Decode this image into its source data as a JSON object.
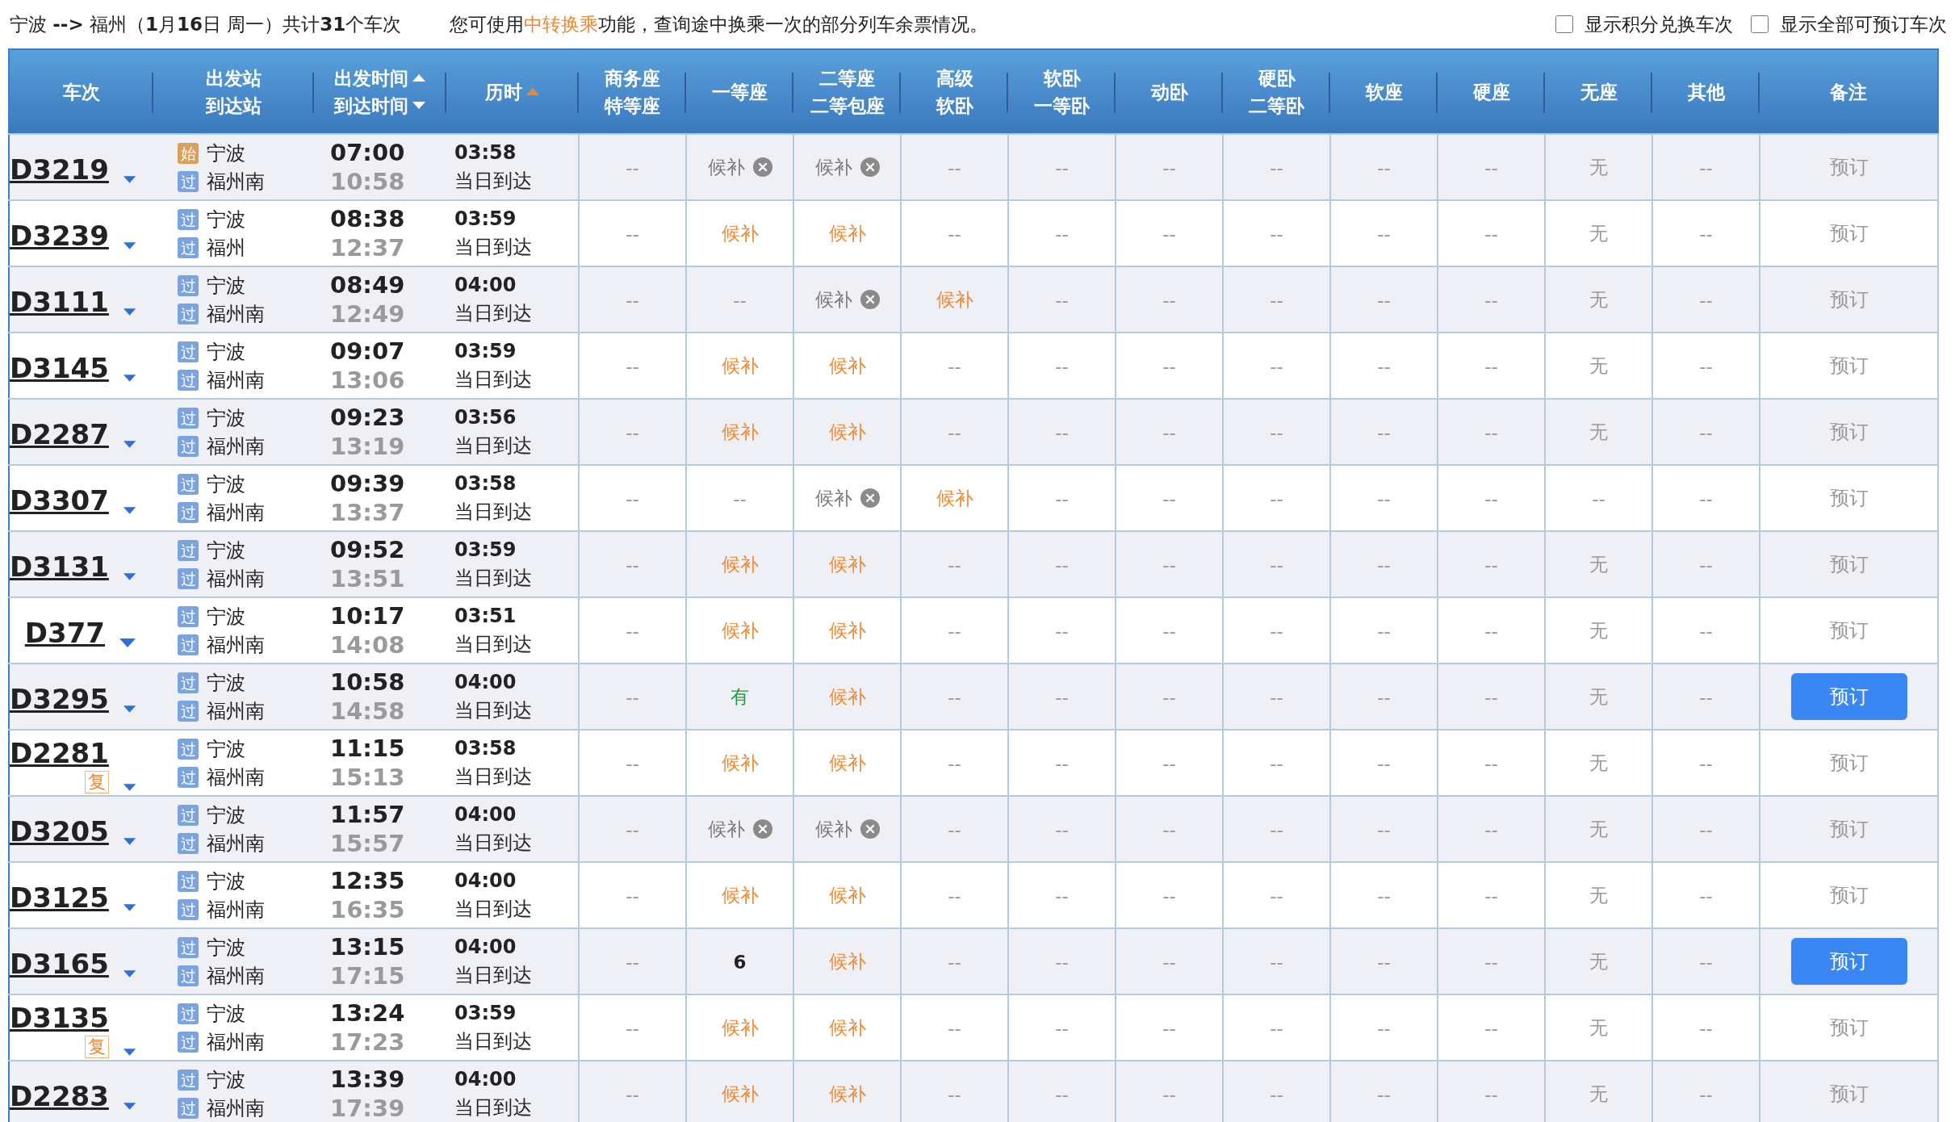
{
  "summary": {
    "text": "宁波 **-->** 福州（**1**月**16**日  周一）共计**31**个车次",
    "hint_before": "您可使用",
    "hint_link": "中转换乘",
    "hint_after": "功能，查询途中换乘一次的部分列车余票情况。"
  },
  "filters": [
    {
      "label": "显示积分兑换车次",
      "checked": false
    },
    {
      "label": "显示全部可预订车次",
      "checked": false
    }
  ],
  "table": {
    "columns": [
      {
        "lines": [
          {
            "text": "车次"
          }
        ]
      },
      {
        "lines": [
          {
            "text": "出发站"
          },
          {
            "text": "到达站"
          }
        ]
      },
      {
        "lines": [
          {
            "text": "出发时间",
            "kind": "sort_up",
            "active": false
          },
          {
            "text": "到达时间",
            "kind": "sort_down",
            "active": false
          }
        ]
      },
      {
        "lines": [
          {
            "text": "历时",
            "kind": "sort_up",
            "active": true
          }
        ]
      },
      {
        "lines": [
          {
            "text": "商务座"
          },
          {
            "text": "特等座"
          }
        ]
      },
      {
        "lines": [
          {
            "text": "一等座"
          }
        ]
      },
      {
        "lines": [
          {
            "text": "二等座"
          },
          {
            "text": "二等包座"
          }
        ]
      },
      {
        "lines": [
          {
            "text": "高级"
          },
          {
            "text": "软卧"
          }
        ]
      },
      {
        "lines": [
          {
            "text": "软卧"
          },
          {
            "text": "一等卧"
          }
        ]
      },
      {
        "lines": [
          {
            "text": "动卧"
          }
        ]
      },
      {
        "lines": [
          {
            "text": "硬卧"
          },
          {
            "text": "二等卧"
          }
        ]
      },
      {
        "lines": [
          {
            "text": "软座"
          }
        ]
      },
      {
        "lines": [
          {
            "text": "硬座"
          }
        ]
      },
      {
        "lines": [
          {
            "text": "无座"
          }
        ]
      },
      {
        "lines": [
          {
            "text": "其他"
          }
        ]
      },
      {
        "lines": [
          {
            "text": "备注"
          }
        ]
      }
    ],
    "rows": [
      {
        "train": "D3219",
        "repeat": null,
        "from": {
          "badge": "始",
          "kind": "start",
          "name": "宁波"
        },
        "to": {
          "badge": "过",
          "kind": "pass",
          "name": "福州南"
        },
        "depart": "07:00",
        "arrive": "10:58",
        "duration": "03:58",
        "arrival_day": "当日到达",
        "seats": [
          {
            "text": "--",
            "kind": "dash"
          },
          {
            "text": "候补",
            "kind": "full"
          },
          {
            "text": "候补",
            "kind": "full"
          },
          {
            "text": "--",
            "kind": "dash"
          },
          {
            "text": "--",
            "kind": "dash"
          },
          {
            "text": "--",
            "kind": "dash"
          },
          {
            "text": "--",
            "kind": "dash"
          },
          {
            "text": "--",
            "kind": "dash"
          },
          {
            "text": "--",
            "kind": "dash"
          },
          {
            "text": "无",
            "kind": "none"
          },
          {
            "text": "--",
            "kind": "dash"
          }
        ],
        "book": {
          "label": "预订",
          "enabled": false
        }
      },
      {
        "train": "D3239",
        "repeat": null,
        "from": {
          "badge": "过",
          "kind": "pass",
          "name": "宁波"
        },
        "to": {
          "badge": "过",
          "kind": "pass",
          "name": "福州"
        },
        "depart": "08:38",
        "arrive": "12:37",
        "duration": "03:59",
        "arrival_day": "当日到达",
        "seats": [
          {
            "text": "--",
            "kind": "dash"
          },
          {
            "text": "候补",
            "kind": "waitlist"
          },
          {
            "text": "候补",
            "kind": "waitlist"
          },
          {
            "text": "--",
            "kind": "dash"
          },
          {
            "text": "--",
            "kind": "dash"
          },
          {
            "text": "--",
            "kind": "dash"
          },
          {
            "text": "--",
            "kind": "dash"
          },
          {
            "text": "--",
            "kind": "dash"
          },
          {
            "text": "--",
            "kind": "dash"
          },
          {
            "text": "无",
            "kind": "none"
          },
          {
            "text": "--",
            "kind": "dash"
          }
        ],
        "book": {
          "label": "预订",
          "enabled": false
        }
      },
      {
        "train": "D3111",
        "repeat": null,
        "from": {
          "badge": "过",
          "kind": "pass",
          "name": "宁波"
        },
        "to": {
          "badge": "过",
          "kind": "pass",
          "name": "福州南"
        },
        "depart": "08:49",
        "arrive": "12:49",
        "duration": "04:00",
        "arrival_day": "当日到达",
        "seats": [
          {
            "text": "--",
            "kind": "dash"
          },
          {
            "text": "--",
            "kind": "dash"
          },
          {
            "text": "候补",
            "kind": "full"
          },
          {
            "text": "候补",
            "kind": "waitlist"
          },
          {
            "text": "--",
            "kind": "dash"
          },
          {
            "text": "--",
            "kind": "dash"
          },
          {
            "text": "--",
            "kind": "dash"
          },
          {
            "text": "--",
            "kind": "dash"
          },
          {
            "text": "--",
            "kind": "dash"
          },
          {
            "text": "无",
            "kind": "none"
          },
          {
            "text": "--",
            "kind": "dash"
          }
        ],
        "book": {
          "label": "预订",
          "enabled": false
        }
      },
      {
        "train": "D3145",
        "repeat": null,
        "from": {
          "badge": "过",
          "kind": "pass",
          "name": "宁波"
        },
        "to": {
          "badge": "过",
          "kind": "pass",
          "name": "福州南"
        },
        "depart": "09:07",
        "arrive": "13:06",
        "duration": "03:59",
        "arrival_day": "当日到达",
        "seats": [
          {
            "text": "--",
            "kind": "dash"
          },
          {
            "text": "候补",
            "kind": "waitlist"
          },
          {
            "text": "候补",
            "kind": "waitlist"
          },
          {
            "text": "--",
            "kind": "dash"
          },
          {
            "text": "--",
            "kind": "dash"
          },
          {
            "text": "--",
            "kind": "dash"
          },
          {
            "text": "--",
            "kind": "dash"
          },
          {
            "text": "--",
            "kind": "dash"
          },
          {
            "text": "--",
            "kind": "dash"
          },
          {
            "text": "无",
            "kind": "none"
          },
          {
            "text": "--",
            "kind": "dash"
          }
        ],
        "book": {
          "label": "预订",
          "enabled": false
        }
      },
      {
        "train": "D2287",
        "repeat": null,
        "from": {
          "badge": "过",
          "kind": "pass",
          "name": "宁波"
        },
        "to": {
          "badge": "过",
          "kind": "pass",
          "name": "福州南"
        },
        "depart": "09:23",
        "arrive": "13:19",
        "duration": "03:56",
        "arrival_day": "当日到达",
        "seats": [
          {
            "text": "--",
            "kind": "dash"
          },
          {
            "text": "候补",
            "kind": "waitlist"
          },
          {
            "text": "候补",
            "kind": "waitlist"
          },
          {
            "text": "--",
            "kind": "dash"
          },
          {
            "text": "--",
            "kind": "dash"
          },
          {
            "text": "--",
            "kind": "dash"
          },
          {
            "text": "--",
            "kind": "dash"
          },
          {
            "text": "--",
            "kind": "dash"
          },
          {
            "text": "--",
            "kind": "dash"
          },
          {
            "text": "无",
            "kind": "none"
          },
          {
            "text": "--",
            "kind": "dash"
          }
        ],
        "book": {
          "label": "预订",
          "enabled": false
        }
      },
      {
        "train": "D3307",
        "repeat": null,
        "from": {
          "badge": "过",
          "kind": "pass",
          "name": "宁波"
        },
        "to": {
          "badge": "过",
          "kind": "pass",
          "name": "福州南"
        },
        "depart": "09:39",
        "arrive": "13:37",
        "duration": "03:58",
        "arrival_day": "当日到达",
        "seats": [
          {
            "text": "--",
            "kind": "dash"
          },
          {
            "text": "--",
            "kind": "dash"
          },
          {
            "text": "候补",
            "kind": "full"
          },
          {
            "text": "候补",
            "kind": "waitlist"
          },
          {
            "text": "--",
            "kind": "dash"
          },
          {
            "text": "--",
            "kind": "dash"
          },
          {
            "text": "--",
            "kind": "dash"
          },
          {
            "text": "--",
            "kind": "dash"
          },
          {
            "text": "--",
            "kind": "dash"
          },
          {
            "text": "--",
            "kind": "dash"
          },
          {
            "text": "--",
            "kind": "dash"
          }
        ],
        "book": {
          "label": "预订",
          "enabled": false
        }
      },
      {
        "train": "D3131",
        "repeat": null,
        "from": {
          "badge": "过",
          "kind": "pass",
          "name": "宁波"
        },
        "to": {
          "badge": "过",
          "kind": "pass",
          "name": "福州南"
        },
        "depart": "09:52",
        "arrive": "13:51",
        "duration": "03:59",
        "arrival_day": "当日到达",
        "seats": [
          {
            "text": "--",
            "kind": "dash"
          },
          {
            "text": "候补",
            "kind": "waitlist"
          },
          {
            "text": "候补",
            "kind": "waitlist"
          },
          {
            "text": "--",
            "kind": "dash"
          },
          {
            "text": "--",
            "kind": "dash"
          },
          {
            "text": "--",
            "kind": "dash"
          },
          {
            "text": "--",
            "kind": "dash"
          },
          {
            "text": "--",
            "kind": "dash"
          },
          {
            "text": "--",
            "kind": "dash"
          },
          {
            "text": "无",
            "kind": "none"
          },
          {
            "text": "--",
            "kind": "dash"
          }
        ],
        "book": {
          "label": "预订",
          "enabled": false
        }
      },
      {
        "train": "D377",
        "repeat": null,
        "from": {
          "badge": "过",
          "kind": "pass",
          "name": "宁波"
        },
        "to": {
          "badge": "过",
          "kind": "pass",
          "name": "福州南"
        },
        "depart": "10:17",
        "arrive": "14:08",
        "duration": "03:51",
        "arrival_day": "当日到达",
        "seats": [
          {
            "text": "--",
            "kind": "dash"
          },
          {
            "text": "候补",
            "kind": "waitlist"
          },
          {
            "text": "候补",
            "kind": "waitlist"
          },
          {
            "text": "--",
            "kind": "dash"
          },
          {
            "text": "--",
            "kind": "dash"
          },
          {
            "text": "--",
            "kind": "dash"
          },
          {
            "text": "--",
            "kind": "dash"
          },
          {
            "text": "--",
            "kind": "dash"
          },
          {
            "text": "--",
            "kind": "dash"
          },
          {
            "text": "无",
            "kind": "none"
          },
          {
            "text": "--",
            "kind": "dash"
          }
        ],
        "book": {
          "label": "预订",
          "enabled": false
        }
      },
      {
        "train": "D3295",
        "repeat": null,
        "from": {
          "badge": "过",
          "kind": "pass",
          "name": "宁波"
        },
        "to": {
          "badge": "过",
          "kind": "pass",
          "name": "福州南"
        },
        "depart": "10:58",
        "arrive": "14:58",
        "duration": "04:00",
        "arrival_day": "当日到达",
        "seats": [
          {
            "text": "--",
            "kind": "dash"
          },
          {
            "text": "有",
            "kind": "available"
          },
          {
            "text": "候补",
            "kind": "waitlist"
          },
          {
            "text": "--",
            "kind": "dash"
          },
          {
            "text": "--",
            "kind": "dash"
          },
          {
            "text": "--",
            "kind": "dash"
          },
          {
            "text": "--",
            "kind": "dash"
          },
          {
            "text": "--",
            "kind": "dash"
          },
          {
            "text": "--",
            "kind": "dash"
          },
          {
            "text": "无",
            "kind": "none"
          },
          {
            "text": "--",
            "kind": "dash"
          }
        ],
        "book": {
          "label": "预订",
          "enabled": true
        }
      },
      {
        "train": "D2281",
        "repeat": "复",
        "from": {
          "badge": "过",
          "kind": "pass",
          "name": "宁波"
        },
        "to": {
          "badge": "过",
          "kind": "pass",
          "name": "福州南"
        },
        "depart": "11:15",
        "arrive": "15:13",
        "duration": "03:58",
        "arrival_day": "当日到达",
        "seats": [
          {
            "text": "--",
            "kind": "dash"
          },
          {
            "text": "候补",
            "kind": "waitlist"
          },
          {
            "text": "候补",
            "kind": "waitlist"
          },
          {
            "text": "--",
            "kind": "dash"
          },
          {
            "text": "--",
            "kind": "dash"
          },
          {
            "text": "--",
            "kind": "dash"
          },
          {
            "text": "--",
            "kind": "dash"
          },
          {
            "text": "--",
            "kind": "dash"
          },
          {
            "text": "--",
            "kind": "dash"
          },
          {
            "text": "无",
            "kind": "none"
          },
          {
            "text": "--",
            "kind": "dash"
          }
        ],
        "book": {
          "label": "预订",
          "enabled": false
        }
      },
      {
        "train": "D3205",
        "repeat": null,
        "from": {
          "badge": "过",
          "kind": "pass",
          "name": "宁波"
        },
        "to": {
          "badge": "过",
          "kind": "pass",
          "name": "福州南"
        },
        "depart": "11:57",
        "arrive": "15:57",
        "duration": "04:00",
        "arrival_day": "当日到达",
        "seats": [
          {
            "text": "--",
            "kind": "dash"
          },
          {
            "text": "候补",
            "kind": "full"
          },
          {
            "text": "候补",
            "kind": "full"
          },
          {
            "text": "--",
            "kind": "dash"
          },
          {
            "text": "--",
            "kind": "dash"
          },
          {
            "text": "--",
            "kind": "dash"
          },
          {
            "text": "--",
            "kind": "dash"
          },
          {
            "text": "--",
            "kind": "dash"
          },
          {
            "text": "--",
            "kind": "dash"
          },
          {
            "text": "无",
            "kind": "none"
          },
          {
            "text": "--",
            "kind": "dash"
          }
        ],
        "book": {
          "label": "预订",
          "enabled": false
        }
      },
      {
        "train": "D3125",
        "repeat": null,
        "from": {
          "badge": "过",
          "kind": "pass",
          "name": "宁波"
        },
        "to": {
          "badge": "过",
          "kind": "pass",
          "name": "福州南"
        },
        "depart": "12:35",
        "arrive": "16:35",
        "duration": "04:00",
        "arrival_day": "当日到达",
        "seats": [
          {
            "text": "--",
            "kind": "dash"
          },
          {
            "text": "候补",
            "kind": "waitlist"
          },
          {
            "text": "候补",
            "kind": "waitlist"
          },
          {
            "text": "--",
            "kind": "dash"
          },
          {
            "text": "--",
            "kind": "dash"
          },
          {
            "text": "--",
            "kind": "dash"
          },
          {
            "text": "--",
            "kind": "dash"
          },
          {
            "text": "--",
            "kind": "dash"
          },
          {
            "text": "--",
            "kind": "dash"
          },
          {
            "text": "无",
            "kind": "none"
          },
          {
            "text": "--",
            "kind": "dash"
          }
        ],
        "book": {
          "label": "预订",
          "enabled": false
        }
      },
      {
        "train": "D3165",
        "repeat": null,
        "from": {
          "badge": "过",
          "kind": "pass",
          "name": "宁波"
        },
        "to": {
          "badge": "过",
          "kind": "pass",
          "name": "福州南"
        },
        "depart": "13:15",
        "arrive": "17:15",
        "duration": "04:00",
        "arrival_day": "当日到达",
        "seats": [
          {
            "text": "--",
            "kind": "dash"
          },
          {
            "text": "6",
            "kind": "count"
          },
          {
            "text": "候补",
            "kind": "waitlist"
          },
          {
            "text": "--",
            "kind": "dash"
          },
          {
            "text": "--",
            "kind": "dash"
          },
          {
            "text": "--",
            "kind": "dash"
          },
          {
            "text": "--",
            "kind": "dash"
          },
          {
            "text": "--",
            "kind": "dash"
          },
          {
            "text": "--",
            "kind": "dash"
          },
          {
            "text": "无",
            "kind": "none"
          },
          {
            "text": "--",
            "kind": "dash"
          }
        ],
        "book": {
          "label": "预订",
          "enabled": true
        }
      },
      {
        "train": "D3135",
        "repeat": "复",
        "from": {
          "badge": "过",
          "kind": "pass",
          "name": "宁波"
        },
        "to": {
          "badge": "过",
          "kind": "pass",
          "name": "福州南"
        },
        "depart": "13:24",
        "arrive": "17:23",
        "duration": "03:59",
        "arrival_day": "当日到达",
        "seats": [
          {
            "text": "--",
            "kind": "dash"
          },
          {
            "text": "候补",
            "kind": "waitlist"
          },
          {
            "text": "候补",
            "kind": "waitlist"
          },
          {
            "text": "--",
            "kind": "dash"
          },
          {
            "text": "--",
            "kind": "dash"
          },
          {
            "text": "--",
            "kind": "dash"
          },
          {
            "text": "--",
            "kind": "dash"
          },
          {
            "text": "--",
            "kind": "dash"
          },
          {
            "text": "--",
            "kind": "dash"
          },
          {
            "text": "无",
            "kind": "none"
          },
          {
            "text": "--",
            "kind": "dash"
          }
        ],
        "book": {
          "label": "预订",
          "enabled": false
        }
      },
      {
        "train": "D2283",
        "repeat": null,
        "from": {
          "badge": "过",
          "kind": "pass",
          "name": "宁波"
        },
        "to": {
          "badge": "过",
          "kind": "pass",
          "name": "福州南"
        },
        "depart": "13:39",
        "arrive": "17:39",
        "duration": "04:00",
        "arrival_day": "当日到达",
        "seats": [
          {
            "text": "--",
            "kind": "dash"
          },
          {
            "text": "候补",
            "kind": "waitlist"
          },
          {
            "text": "候补",
            "kind": "waitlist"
          },
          {
            "text": "--",
            "kind": "dash"
          },
          {
            "text": "--",
            "kind": "dash"
          },
          {
            "text": "--",
            "kind": "dash"
          },
          {
            "text": "--",
            "kind": "dash"
          },
          {
            "text": "--",
            "kind": "dash"
          },
          {
            "text": "--",
            "kind": "dash"
          },
          {
            "text": "无",
            "kind": "none"
          },
          {
            "text": "--",
            "kind": "dash"
          }
        ],
        "book": {
          "label": "预订",
          "enabled": false
        }
      }
    ]
  }
}
